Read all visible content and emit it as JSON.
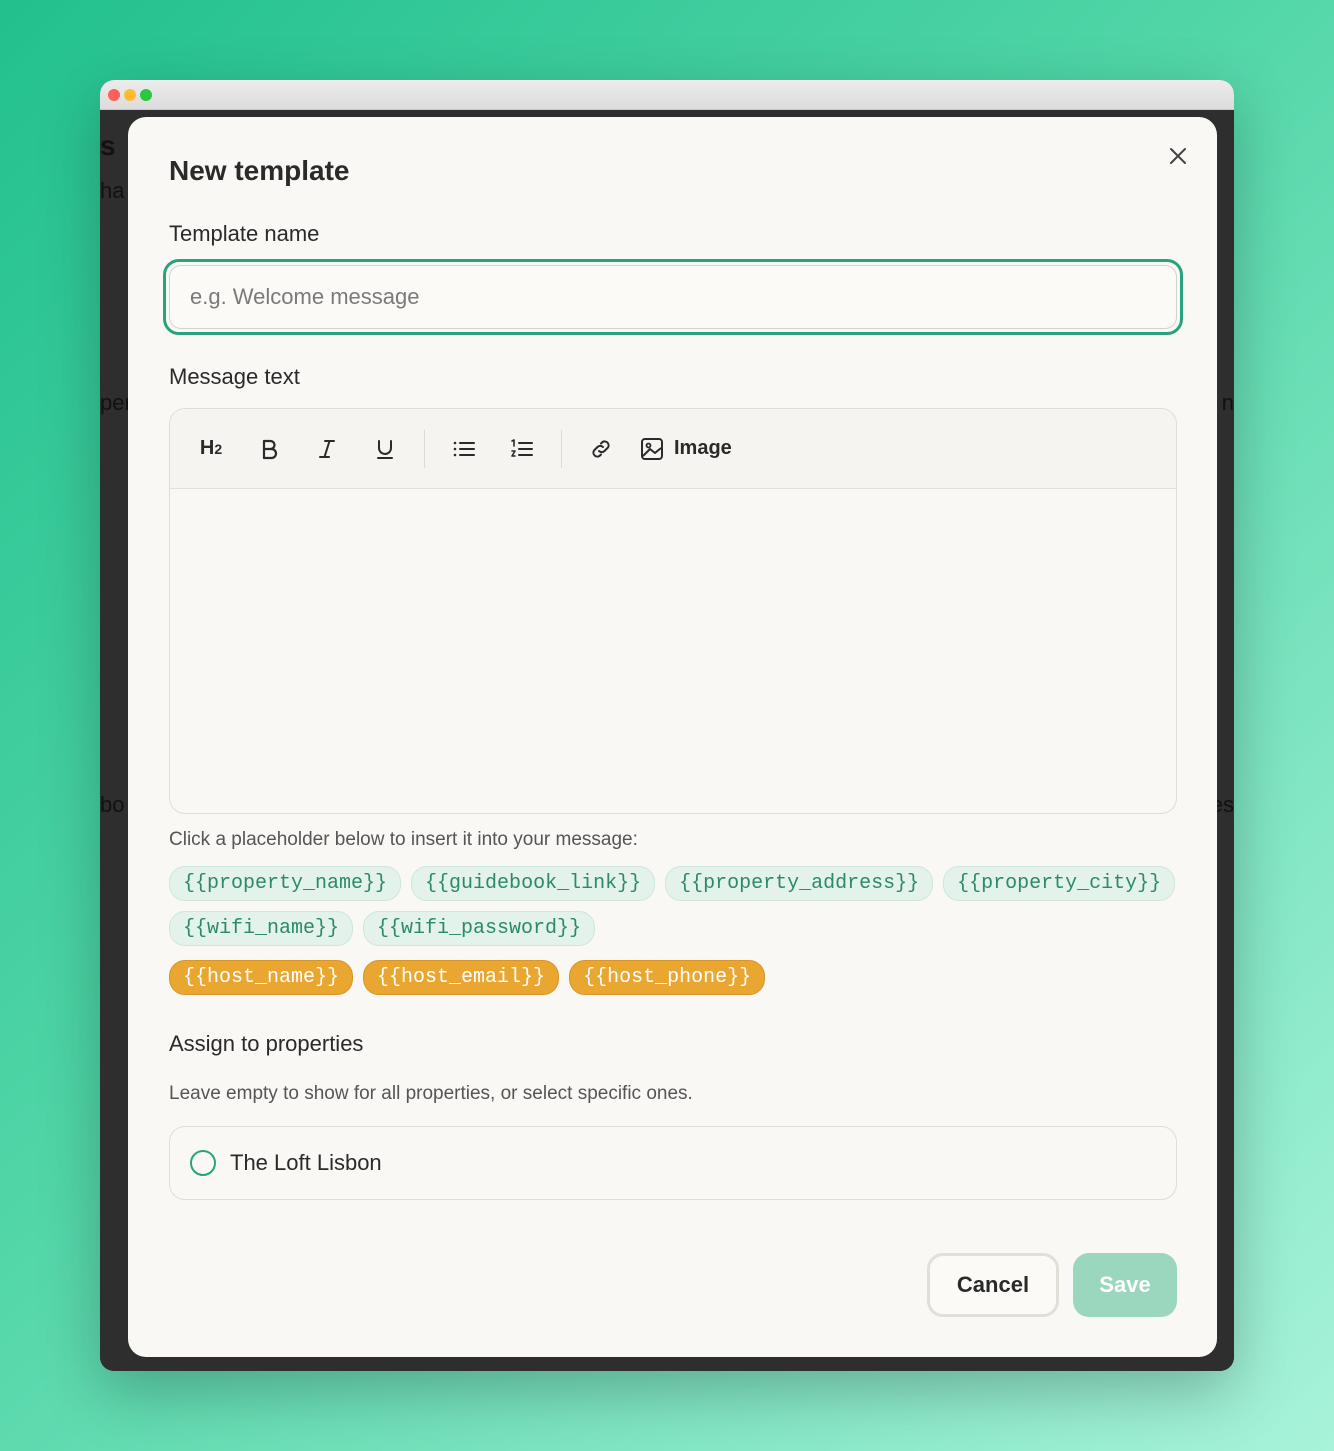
{
  "background_fragments": [
    "s",
    "ha",
    "per",
    "n",
    "bo",
    "es"
  ],
  "modal": {
    "title": "New template",
    "close_icon": "close-icon"
  },
  "template_name": {
    "label": "Template name",
    "value": "",
    "placeholder": "e.g. Welcome message"
  },
  "message": {
    "label": "Message text",
    "toolbar": {
      "heading_label": "H2",
      "image_label": "Image",
      "icons": [
        "heading-icon",
        "bold-icon",
        "italic-icon",
        "underline-icon",
        "bullet-list-icon",
        "numbered-list-icon",
        "link-icon",
        "image-icon"
      ]
    },
    "body": ""
  },
  "placeholders": {
    "hint": "Click a placeholder below to insert it into your message:",
    "property_chips": [
      "{{property_name}}",
      "{{guidebook_link}}",
      "{{property_address}}",
      "{{property_city}}"
    ],
    "wifi_chips": [
      "{{wifi_name}}",
      "{{wifi_password}}"
    ],
    "host_chips": [
      "{{host_name}}",
      "{{host_email}}",
      "{{host_phone}}"
    ]
  },
  "assign": {
    "label": "Assign to properties",
    "hint": "Leave empty to show for all properties, or select specific ones.",
    "properties": [
      {
        "name": "The Loft Lisbon",
        "selected": false
      }
    ]
  },
  "footer": {
    "cancel_label": "Cancel",
    "save_label": "Save"
  },
  "colors": {
    "accent": "#2aa37d",
    "chip_green_bg": "#e3f2ea",
    "chip_orange_bg": "#e9a630",
    "save_disabled": "#9bd6bf"
  }
}
